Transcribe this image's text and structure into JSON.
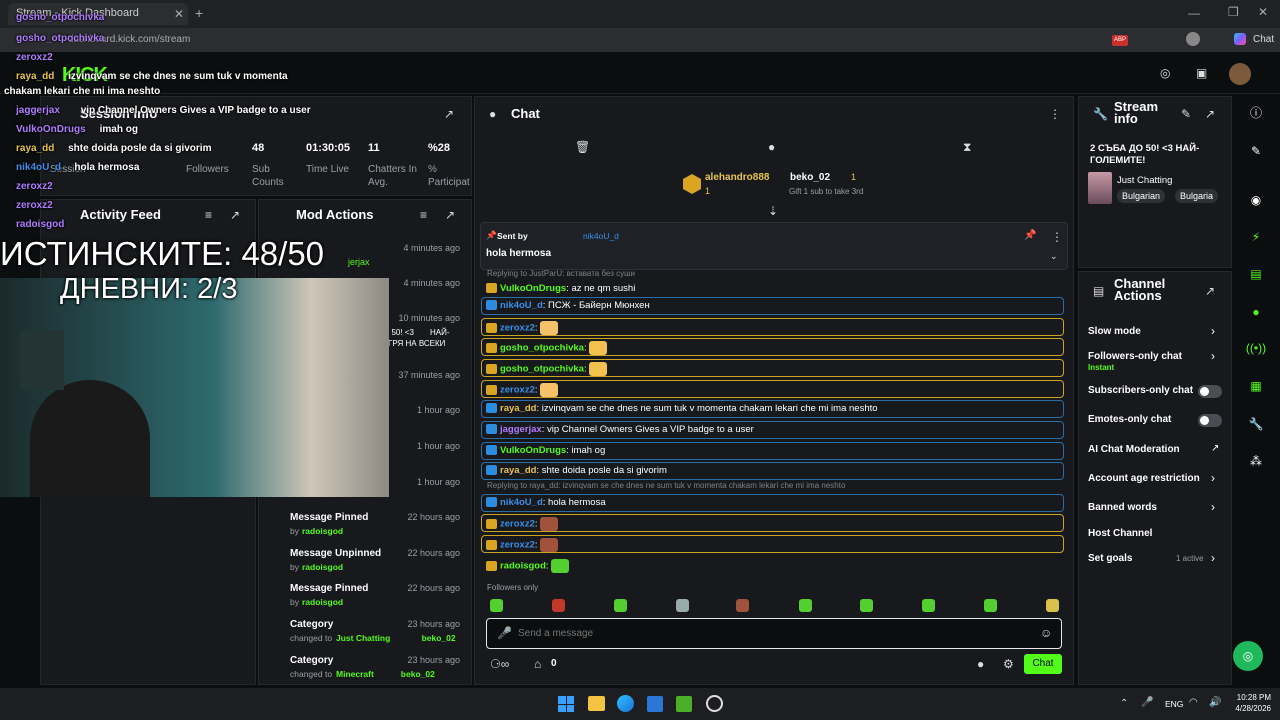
{
  "browser": {
    "tab_title": "Stream - Kick Dashboard",
    "url": "dashboard.kick.com/stream",
    "chat_button": "Chat",
    "adblock_badge": "ABP"
  },
  "session": {
    "title": "Session info",
    "stats": [
      {
        "value": "",
        "label": "Session"
      },
      {
        "value": "",
        "label": "Followers"
      },
      {
        "value": "48",
        "label": "Sub Counts"
      },
      {
        "value": "01:30:05",
        "label": "Time Live"
      },
      {
        "value": "11",
        "label": "Chatters In Avg."
      },
      {
        "value": "%28",
        "label": "% Participat"
      }
    ]
  },
  "activity": {
    "title": "Activity Feed"
  },
  "mod_actions": {
    "title": "Mod Actions",
    "items": [
      {
        "title": "",
        "sub": "",
        "by": "",
        "time": "4 minutes ago"
      },
      {
        "title": "",
        "sub": "",
        "by": "",
        "time": "4 minutes ago"
      },
      {
        "title": "",
        "sub": "",
        "by": "",
        "time": "10 minutes ago"
      },
      {
        "title": "",
        "sub": "",
        "by": "",
        "time": "37 minutes ago"
      },
      {
        "title": "",
        "sub": "",
        "by": "",
        "time": "1 hour ago"
      },
      {
        "title": "",
        "sub": "",
        "by": "",
        "time": "1 hour ago"
      },
      {
        "title": "",
        "sub": "",
        "by": "",
        "time": "1 hour ago"
      },
      {
        "title": "Message Pinned",
        "sub": "by",
        "by": "radoisgod",
        "time": "22 hours ago"
      },
      {
        "title": "Message Unpinned",
        "sub": "by",
        "by": "radoisgod",
        "time": "22 hours ago"
      },
      {
        "title": "Message Pinned",
        "sub": "by",
        "by": "radoisgod",
        "time": "22 hours ago"
      },
      {
        "title": "Category",
        "sub": "changed to",
        "by": "Just Chatting",
        "by2": "beko_02",
        "time": "23 hours ago"
      },
      {
        "title": "Category",
        "sub": "changed to",
        "by": "Minecraft",
        "by2": "beko_02",
        "time": "23 hours ago"
      }
    ],
    "snippet1": "jerjax",
    "snippet2": "О 50! <3",
    "snippet2b": "НАЙ-",
    "snippet3": "ГРЯ НА ВСЕКИ"
  },
  "chat": {
    "title": "Chat",
    "gifters": [
      {
        "name": "alehandro888",
        "count": "1"
      },
      {
        "name": "beko_02",
        "count": "1",
        "hint": "Gift 1 sub to take 3rd"
      }
    ],
    "pinned": {
      "label": "Sent by",
      "user": "nik4oU_d",
      "text": "hola hermosa"
    },
    "reply_top": "Replying to JustParU: вставата без суши",
    "messages": [
      {
        "user": "VulkoOnDrugs",
        "text": "az ne qm sushi",
        "style": "none",
        "color": "#53fc18"
      },
      {
        "user": "nik4oU_d",
        "text": "ПСЖ - Байерн Мюнхен",
        "style": "blue",
        "color": "#3a8fe8"
      },
      {
        "user": "zeroxz2",
        "text": "",
        "style": "gold",
        "color": "#3a8fe8",
        "emote": "#f5c26b"
      },
      {
        "user": "gosho_otpochivka",
        "text": "",
        "style": "gold",
        "color": "#53fc18",
        "emote": "#f2c14e"
      },
      {
        "user": "gosho_otpochivka",
        "text": "",
        "style": "gold",
        "color": "#53fc18",
        "emote": "#f2c14e"
      },
      {
        "user": "zeroxz2",
        "text": "",
        "style": "gold",
        "color": "#3a8fe8",
        "emote": "#f5c26b"
      },
      {
        "user": "raya_dd",
        "text": "izvinqvam se che dnes ne sum tuk v momenta chakam lekari che mi ima neshto",
        "style": "blue",
        "color": "#e8c34a"
      },
      {
        "user": "jaggerjax",
        "text": "vip Channel Owners Gives a VIP badge to a user",
        "style": "blue",
        "color": "#b07cff"
      },
      {
        "user": "VulkoOnDrugs",
        "text": "imah og",
        "style": "blue",
        "color": "#53fc18"
      },
      {
        "user": "raya_dd",
        "text": "shte doida posle da si givorim",
        "style": "blue",
        "color": "#e8c34a"
      },
      {
        "user": "nik4oU_d",
        "text": "hola hermosa",
        "style": "blue",
        "color": "#3a8fe8",
        "reply": "Replying to raya_dd: izvinqvam se che dnes ne sum tuk v momenta chakam lekari che mi ima neshto"
      },
      {
        "user": "zeroxz2",
        "text": "",
        "style": "gold",
        "color": "#3a8fe8",
        "emote": "#a0523d"
      },
      {
        "user": "zeroxz2",
        "text": "",
        "style": "gold",
        "color": "#3a8fe8",
        "emote": "#a0523d"
      },
      {
        "user": "radoisgod",
        "text": "",
        "style": "none",
        "color": "#53fc18",
        "emote": "#53d02f"
      }
    ],
    "followers_only": "Followers only",
    "input_placeholder": "Send a message",
    "points": "0",
    "send": "Chat"
  },
  "stream_info": {
    "title": "Stream info",
    "stream_title": "2 СЪБА ДО 50! <3 НАЙ-ГОЛЕМИТЕ!",
    "category": "Just Chatting",
    "tags": [
      "Bulgarian",
      "Bulgaria"
    ]
  },
  "channel_actions": {
    "title": "Channel Actions",
    "items": [
      {
        "label": "Slow mode",
        "kind": "chevron"
      },
      {
        "label": "Followers-only chat",
        "sub": "Instant",
        "kind": "chevron"
      },
      {
        "label": "Subscribers-only chat",
        "kind": "toggle"
      },
      {
        "label": "Emotes-only chat",
        "kind": "toggle"
      },
      {
        "label": "AI Chat Moderation",
        "kind": "external"
      },
      {
        "label": "Account age restriction",
        "kind": "chevron"
      },
      {
        "label": "Banned words",
        "kind": "chevron"
      },
      {
        "label": "Host Channel",
        "kind": "none"
      },
      {
        "label": "Set goals",
        "sub": "1 active",
        "kind": "chevron"
      }
    ]
  },
  "overlay": {
    "big1": "ИСТИНСКИТЕ: 48/50",
    "big2": "ДНЕВНИ: 2/3",
    "chat": [
      {
        "user": "gosho_otpochivka",
        "text": "",
        "color": "#b07cff"
      },
      {
        "user": "gosho_otpochivka",
        "text": "",
        "color": "#b07cff"
      },
      {
        "user": "zeroxz2",
        "text": "",
        "color": "#b07cff"
      },
      {
        "user": "raya_dd",
        "text": "izvinqvam se che dnes ne sum tuk v momenta",
        "color": "#e8c34a"
      },
      {
        "user": "",
        "text": "chakam lekari che mi ima neshto",
        "color": "#fff"
      },
      {
        "user": "jaggerjax",
        "text": "vip Channel Owners Gives a VIP badge to a user",
        "color": "#b07cff"
      },
      {
        "user": "VulkoOnDrugs",
        "text": "imah og",
        "color": "#b07cff"
      },
      {
        "user": "raya_dd",
        "text": "shte doida posle da si givorim",
        "color": "#e8c34a"
      },
      {
        "user": "nik4oU_d",
        "text": "hola hermosa",
        "color": "#3a8fe8"
      },
      {
        "user": "zeroxz2",
        "text": "",
        "color": "#b07cff"
      },
      {
        "user": "zeroxz2",
        "text": "",
        "color": "#b07cff"
      },
      {
        "user": "radoisgod",
        "text": "",
        "color": "#b07cff"
      }
    ]
  },
  "taskbar": {
    "lang": "ENG",
    "time": "10:28 PM",
    "date": "4/28/2026"
  },
  "colors": {
    "accent": "#53fc18",
    "gold": "#caa41e",
    "blue": "#2a6ea8"
  }
}
